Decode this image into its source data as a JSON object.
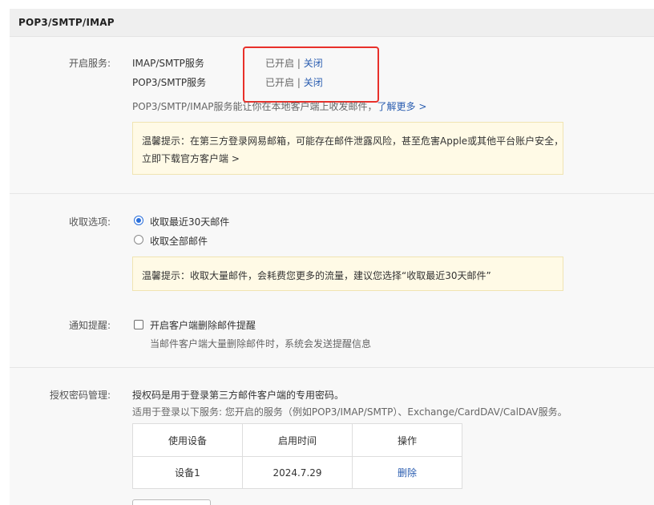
{
  "panel": {
    "title": "POP3/SMTP/IMAP"
  },
  "services": {
    "label": "开启服务:",
    "items": [
      {
        "name": "IMAP/SMTP服务",
        "status": "已开启",
        "separator": "|",
        "action": "关闭"
      },
      {
        "name": "POP3/SMTP服务",
        "status": "已开启",
        "separator": "|",
        "action": "关闭"
      }
    ],
    "description": "POP3/SMTP/IMAP服务能让你在本地客户端上收发邮件，",
    "learn_more": "了解更多 >",
    "tip_line1": "温馨提示：在第三方登录网易邮箱，可能存在邮件泄露风险，甚至危害Apple或其他平台账户安全，",
    "tip_link": "立即下载官方客户端 >"
  },
  "receive": {
    "label": "收取选项:",
    "options": [
      {
        "label": "收取最近30天邮件",
        "checked": true
      },
      {
        "label": "收取全部邮件",
        "checked": false
      }
    ],
    "tip": "温馨提示：收取大量邮件，会耗费您更多的流量，建议您选择“收取最近30天邮件”"
  },
  "notify": {
    "label": "通知提醒:",
    "checkbox_label": "开启客户端删除邮件提醒",
    "checked": false,
    "hint": "当邮件客户端大量删除邮件时，系统会发送提醒信息"
  },
  "auth": {
    "label": "授权密码管理:",
    "desc1": "授权码是用于登录第三方邮件客户端的专用密码。",
    "desc2": "适用于登录以下服务: 您开启的服务（例如POP3/IMAP/SMTP）、Exchange/CardDAV/CalDAV服务。",
    "table": {
      "headers": [
        "使用设备",
        "启用时间",
        "操作"
      ],
      "rows": [
        {
          "device": "设备1",
          "date": "2024.7.29",
          "action": "删除"
        }
      ]
    }
  },
  "colors": {
    "link": "#2a5db0",
    "highlight": "#e8302a",
    "tip_background": "#fffae6"
  }
}
